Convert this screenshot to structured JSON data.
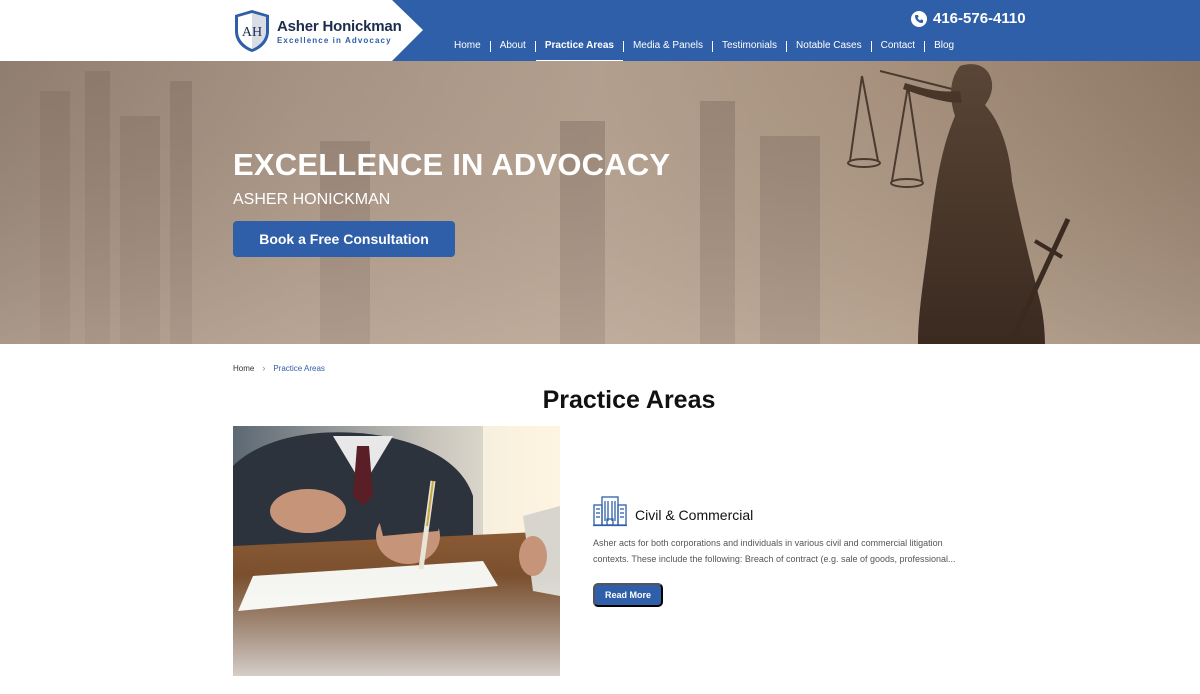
{
  "colors": {
    "brand_blue": "#2f5fa8",
    "navy": "#1d2b4d",
    "white": "#ffffff"
  },
  "header": {
    "logo": {
      "monogram": "AH",
      "name": "Asher Honickman",
      "tagline": "Excellence in Advocacy"
    },
    "phone": {
      "icon": "phone-icon",
      "number": "416-576-4110"
    },
    "nav": [
      {
        "label": "Home",
        "active": false
      },
      {
        "label": "About",
        "active": false
      },
      {
        "label": "Practice Areas",
        "active": true
      },
      {
        "label": "Media & Panels",
        "active": false
      },
      {
        "label": "Testimonials",
        "active": false
      },
      {
        "label": "Notable Cases",
        "active": false
      },
      {
        "label": "Contact",
        "active": false
      },
      {
        "label": "Blog",
        "active": false
      }
    ]
  },
  "hero": {
    "title": "EXCELLENCE IN ADVOCACY",
    "subtitle": "ASHER HONICKMAN",
    "cta": "Book a Free Consultation"
  },
  "breadcrumb": {
    "home": "Home",
    "separator": "›",
    "current": "Practice Areas"
  },
  "main": {
    "title": "Practice Areas",
    "practice_area": {
      "icon": "building-icon",
      "title": "Civil & Commercial",
      "description_line1": "Asher acts for both corporations and individuals in various civil and commercial litigation",
      "description_line2": "contexts. These include the following: Breach of contract (e.g. sale of goods, professional...",
      "button": "Read More"
    }
  }
}
